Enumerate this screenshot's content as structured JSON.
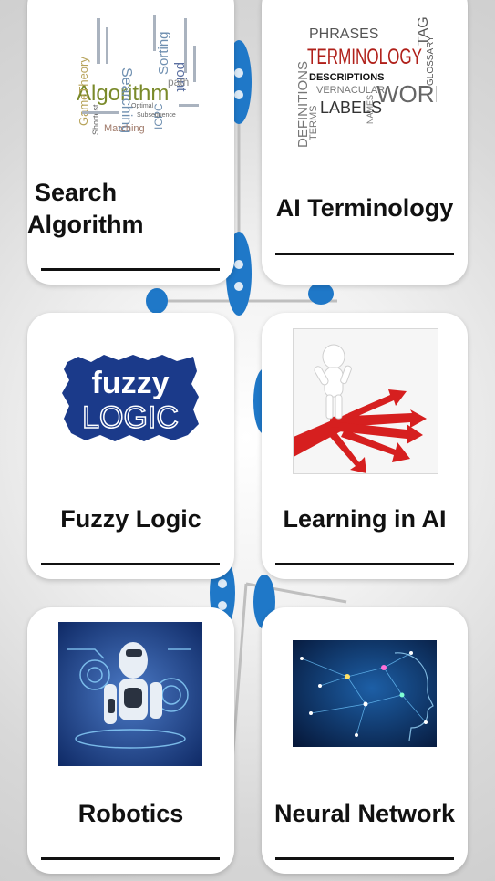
{
  "topics": [
    {
      "id": "search-algorithm",
      "title": "Search",
      "title2": "Algorithm",
      "image": "word-cloud",
      "cloud_words": {
        "main": "Algorithm",
        "w1": "GameTheory",
        "w2": "Searching",
        "w3": "Sorting",
        "w4": "point",
        "w5": "path",
        "w6": "ICPC",
        "w7": "Matching",
        "w8": "Shortest",
        "w9": "Subsequence",
        "w10": "Optimal"
      }
    },
    {
      "id": "ai-terminology",
      "title": "AI Terminology",
      "image": "word-cloud",
      "cloud_words": {
        "phrases": "PHRASES",
        "terminology": "TERMINOLOGY",
        "descriptions": "DESCRIPTIONS",
        "vernacular": "VERNACULAR",
        "labels": "LABELS",
        "words": "WORDS",
        "tag": "TAG",
        "glossary": "GLOSSARY",
        "definitions": "DEFINITIONS",
        "terms": "TERMS",
        "names": "NAMES"
      }
    },
    {
      "id": "fuzzy-logic",
      "title": "Fuzzy Logic",
      "image": "fuzzy-logo",
      "logo_line1": "fuzzy",
      "logo_line2": "LOGIC"
    },
    {
      "id": "learning-in-ai",
      "title": "Learning in AI",
      "image": "crossroads-arrows"
    },
    {
      "id": "robotics",
      "title": "Robotics",
      "image": "humanoid-robot"
    },
    {
      "id": "neural-network",
      "title": "Neural Network",
      "image": "digital-head-network"
    }
  ],
  "colors": {
    "card_background": "#ffffff",
    "title_text": "#111111",
    "divider": "#111111",
    "background_node": "#1f78c8"
  }
}
